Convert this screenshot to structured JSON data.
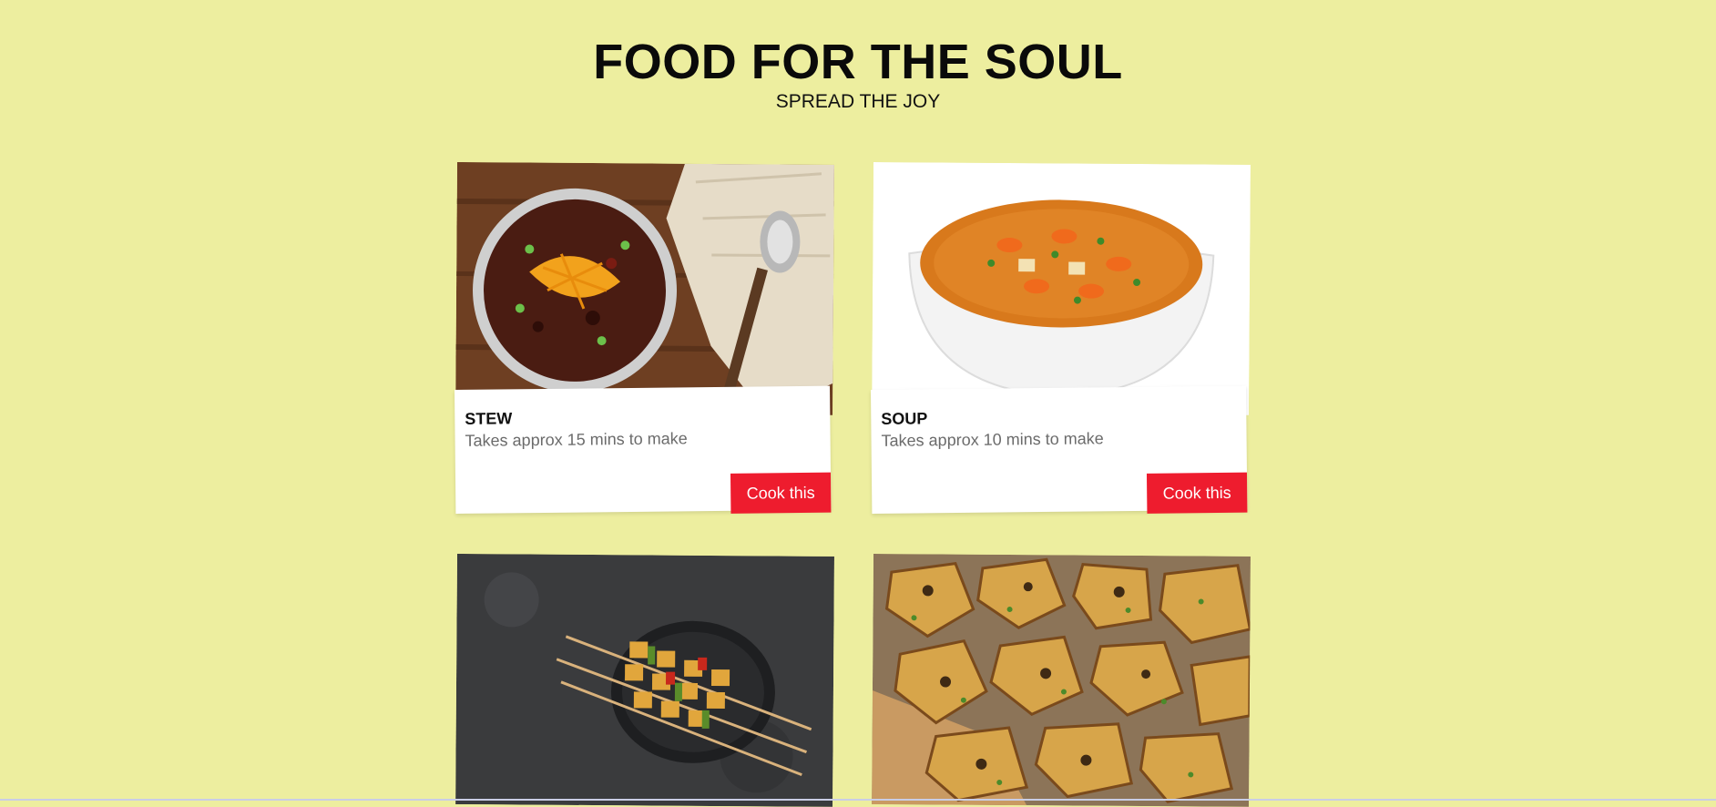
{
  "header": {
    "title": "FOOD FOR THE SOUL",
    "subtitle": "SPREAD THE JOY"
  },
  "cards": [
    {
      "name": "STEW",
      "time": "Takes approx 15 mins to make",
      "button": "Cook this",
      "image": "chili-bowl-photo"
    },
    {
      "name": "SOUP",
      "time": "Takes approx 10 mins to make",
      "button": "Cook this",
      "image": "vegetable-soup-photo"
    },
    {
      "name": "",
      "time": "",
      "button": "",
      "image": "paneer-skewers-photo"
    },
    {
      "name": "",
      "time": "",
      "button": "",
      "image": "roast-potatoes-photo"
    }
  ],
  "colors": {
    "background": "#edee9f",
    "button": "#ee1c2e",
    "card": "#ffffff"
  }
}
